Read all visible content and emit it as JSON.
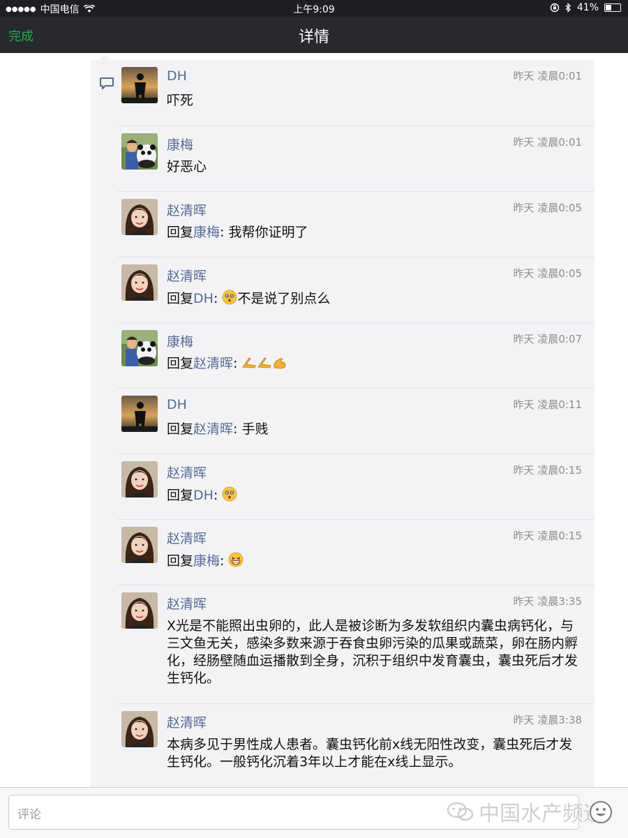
{
  "status_bar": {
    "signal_dots": "●●●●●",
    "carrier": "中国电信",
    "time": "上午9:09",
    "battery_percent": "41%",
    "battery_level": 0.41
  },
  "nav": {
    "done_label": "完成",
    "title": "详情"
  },
  "comments": [
    {
      "name": "DH",
      "time": "昨天 凌晨0:01",
      "prefix": "",
      "reply_to": "",
      "colon": "",
      "text": "吓死"
    },
    {
      "name": "康梅",
      "time": "昨天 凌晨0:01",
      "prefix": "",
      "reply_to": "",
      "colon": "",
      "text": "好恶心"
    },
    {
      "name": "赵清晖",
      "time": "昨天 凌晨0:05",
      "prefix": "回复",
      "reply_to": "康梅",
      "colon": ": ",
      "text": "我帮你证明了"
    },
    {
      "name": "赵清晖",
      "time": "昨天 凌晨0:05",
      "prefix": "回复",
      "reply_to": "DH",
      "colon": ": ",
      "text": "不是说了别点么"
    },
    {
      "name": "康梅",
      "time": "昨天 凌晨0:07",
      "prefix": "回复",
      "reply_to": "赵清晖",
      "colon": ": ",
      "text": ""
    },
    {
      "name": "DH",
      "time": "昨天 凌晨0:11",
      "prefix": "回复",
      "reply_to": "赵清晖",
      "colon": ": ",
      "text": "手贱"
    },
    {
      "name": "赵清晖",
      "time": "昨天 凌晨0:15",
      "prefix": "回复",
      "reply_to": "DH",
      "colon": ": ",
      "text": ""
    },
    {
      "name": "赵清晖",
      "time": "昨天 凌晨0:15",
      "prefix": "回复",
      "reply_to": "康梅",
      "colon": ": ",
      "text": ""
    },
    {
      "name": "赵清晖",
      "time": "昨天 凌晨3:35",
      "prefix": "",
      "reply_to": "",
      "colon": "",
      "text": "X光是不能照出虫卵的，此人是被诊断为多发软组织内囊虫病钙化，与三文鱼无关，感染多数来源于吞食虫卵污染的瓜果或蔬菜，卵在肠内孵化，经肠壁随血运播散到全身，沉积于组织中发育囊虫，囊虫死后才发生钙化。"
    },
    {
      "name": "赵清晖",
      "time": "昨天 凌晨3:38",
      "prefix": "",
      "reply_to": "",
      "colon": "",
      "text": "本病多见于男性成人患者。囊虫钙化前x线无阳性改变，囊虫死后才发生钙化。一般钙化沉着3年以上才能在x线上显示。"
    }
  ],
  "input": {
    "placeholder": "评论"
  },
  "watermark": {
    "text": "中国水产频道"
  }
}
